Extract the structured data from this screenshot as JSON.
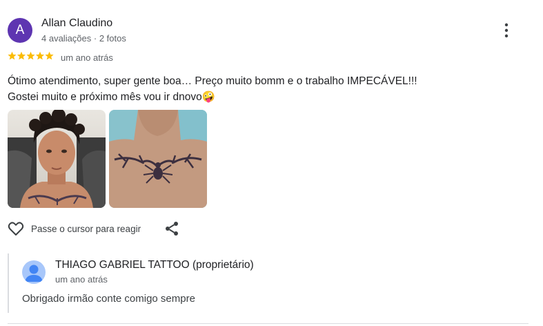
{
  "review": {
    "avatar_letter": "A",
    "author_name": "Allan Claudino",
    "author_meta": "4 avaliações · 2 fotos",
    "rating": 5,
    "time": "um ano atrás",
    "text_line1": "Ótimo atendimento, super gente boa… Preço muito bomm e o trabalho IMPECÁVEL!!!",
    "text_line2": "Gostei muito e próximo mês vou ir dnovo",
    "emoji": "🤪",
    "photos": [
      "photo-portrait",
      "photo-chest-tattoo"
    ],
    "react_label": "Passe o cursor para reagir"
  },
  "owner_response": {
    "name": "THIAGO GABRIEL TATTOO (proprietário)",
    "time": "um ano atrás",
    "text": "Obrigado irmão conte comigo sempre"
  },
  "colors": {
    "avatar_bg": "#5e35b1",
    "star": "#fbbc04",
    "owner_avatar_bg": "#a8c7fa",
    "owner_avatar_fg": "#4285f4"
  },
  "icons": [
    "more-vert-icon",
    "star-icon",
    "heart-outline-icon",
    "share-icon",
    "default-avatar-icon"
  ]
}
